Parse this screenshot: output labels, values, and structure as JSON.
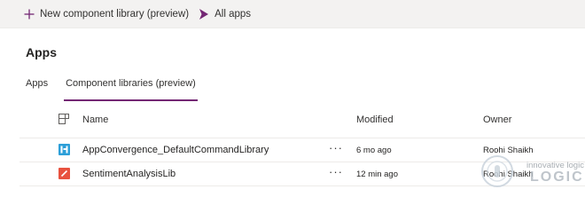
{
  "command_bar": {
    "new_library_label": "New component library (preview)",
    "all_apps_label": "All apps",
    "accent_color": "#742774"
  },
  "page": {
    "title": "Apps"
  },
  "tabs": [
    {
      "label": "Apps",
      "active": false
    },
    {
      "label": "Component libraries (preview)",
      "active": true
    }
  ],
  "table": {
    "columns": {
      "icon": "app-type-icon",
      "name": "Name",
      "modified": "Modified",
      "owner": "Owner"
    },
    "rows": [
      {
        "icon": "component-library-icon",
        "icon_color": "#2d9fd8",
        "name": "AppConvergence_DefaultCommandLibrary",
        "more": "···",
        "modified": "6 mo ago",
        "owner": "Roohi Shaikh"
      },
      {
        "icon": "pencil-icon",
        "icon_color": "#e8523f",
        "name": "SentimentAnalysisLib",
        "more": "···",
        "modified": "12 min ago",
        "owner": "Roohi Shaikh"
      }
    ]
  },
  "watermark": {
    "tagline": "innovative logic",
    "brand": "LOGIC"
  }
}
